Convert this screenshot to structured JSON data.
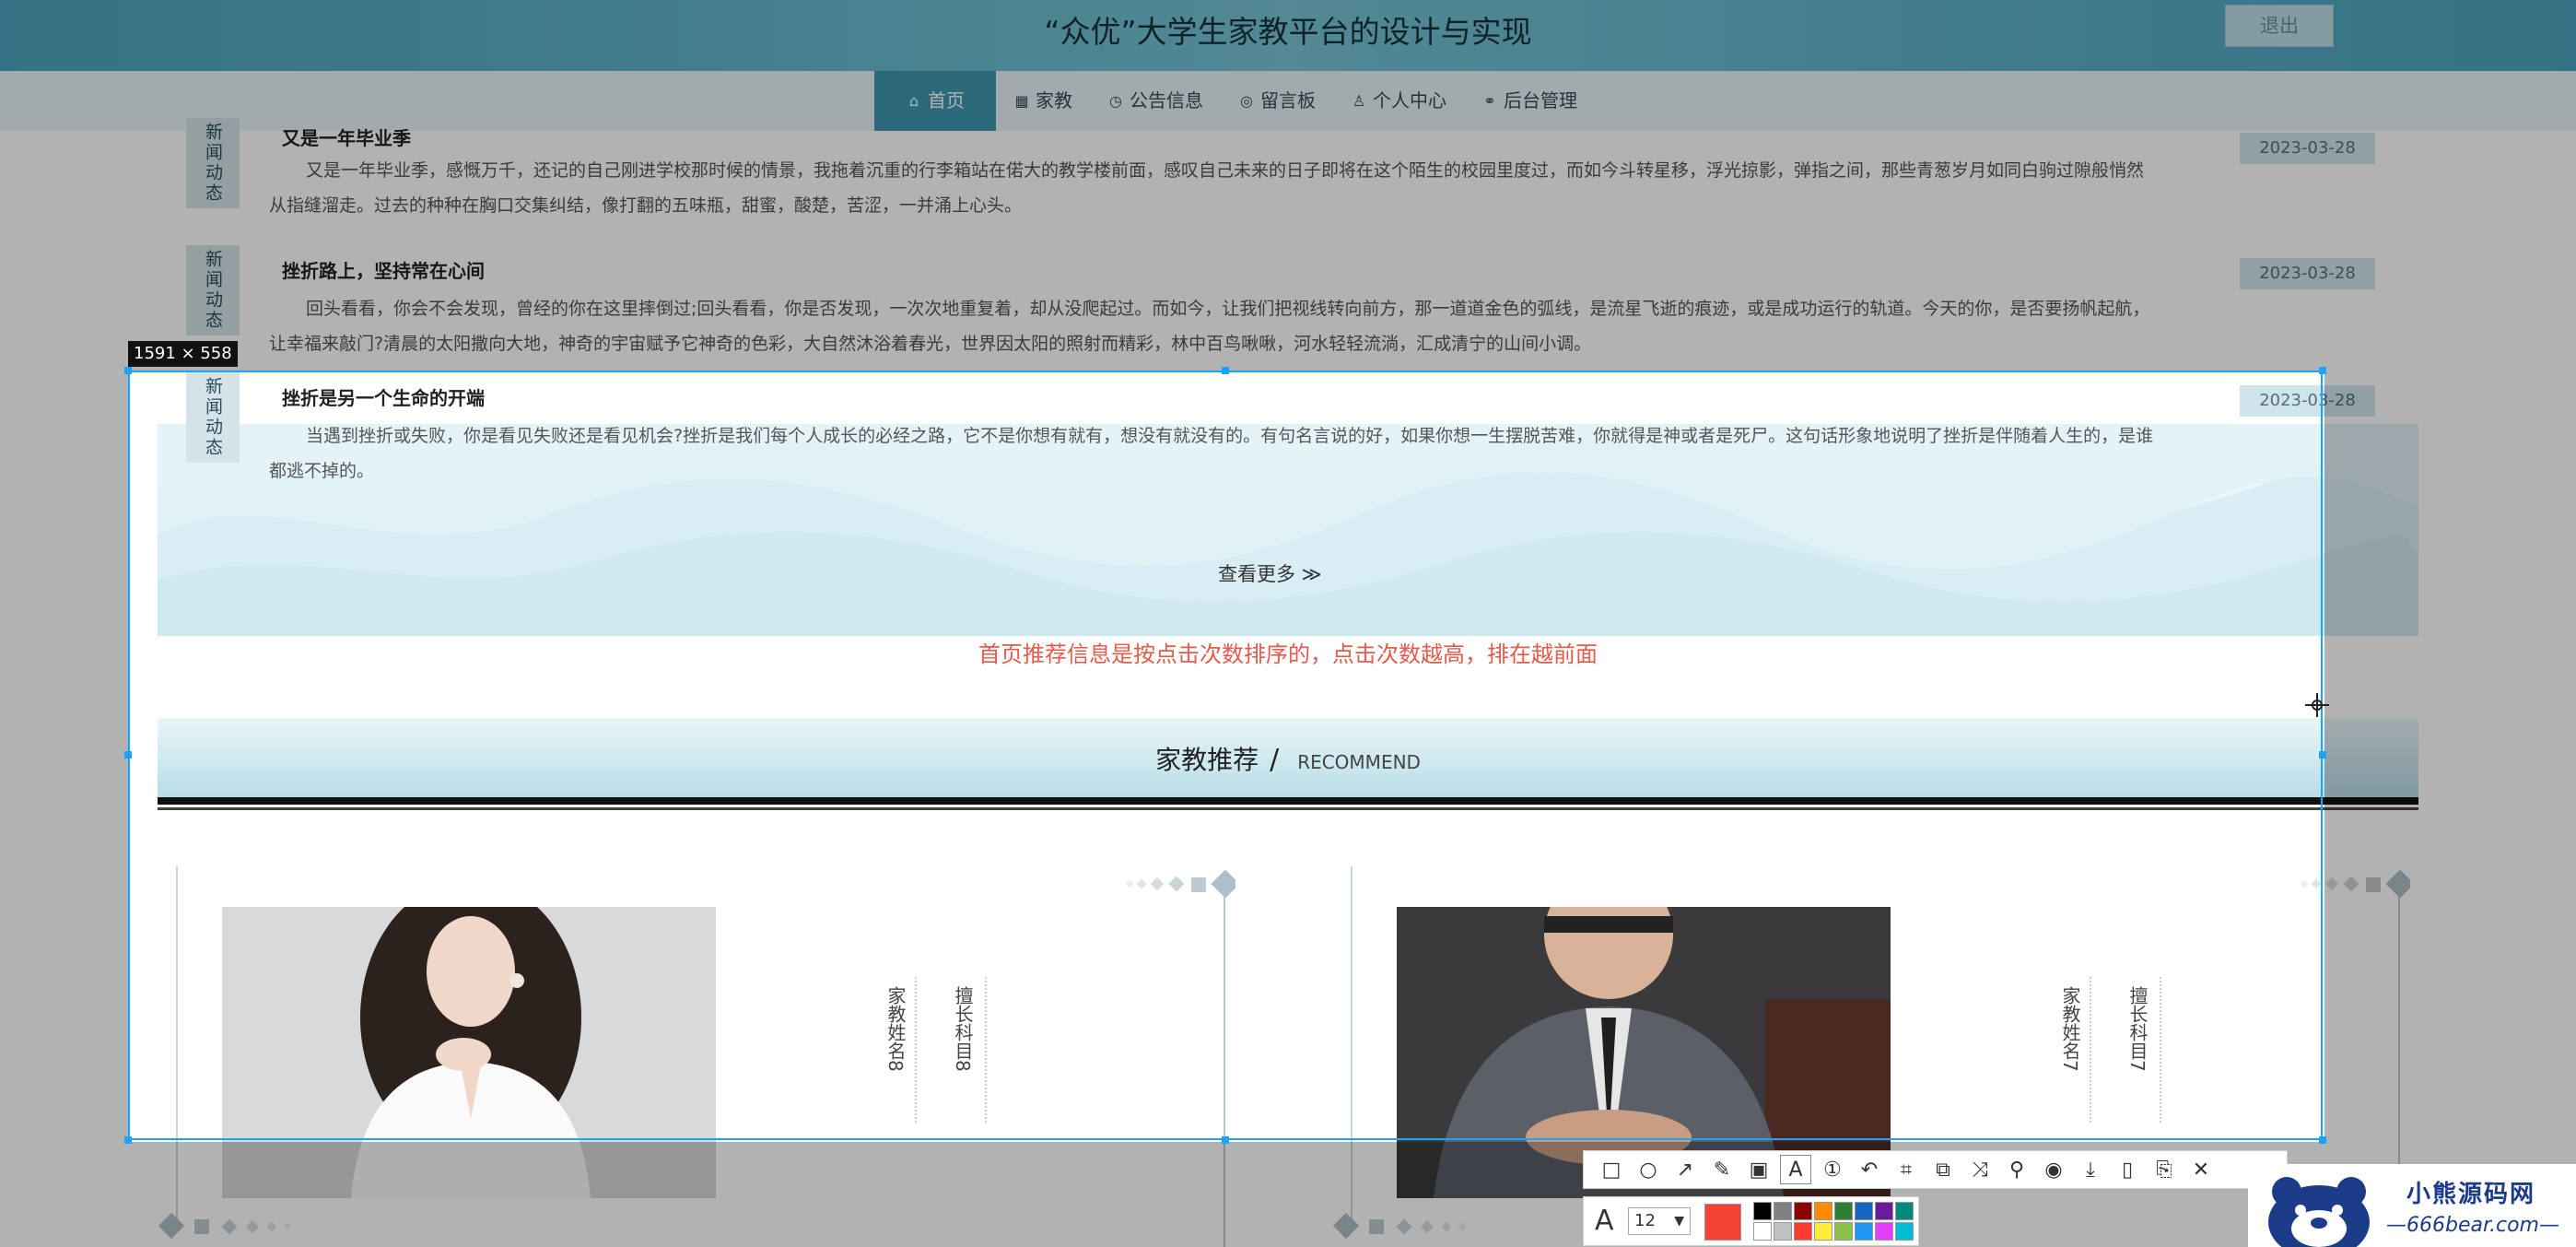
{
  "header": {
    "title": "“众优”大学生家教平台的设计与实现",
    "logout_label": "退出"
  },
  "nav": [
    {
      "label": "首页",
      "icon": "home-icon",
      "glyph": "⌂",
      "active": true
    },
    {
      "label": "家教",
      "icon": "calendar-icon",
      "glyph": "▦",
      "active": false
    },
    {
      "label": "公告信息",
      "icon": "clock-icon",
      "glyph": "◷",
      "active": false
    },
    {
      "label": "留言板",
      "icon": "globe-icon",
      "glyph": "◎",
      "active": false
    },
    {
      "label": "个人中心",
      "icon": "user-icon",
      "glyph": "♙",
      "active": false
    },
    {
      "label": "后台管理",
      "icon": "link-icon",
      "glyph": "⚭",
      "active": false
    }
  ],
  "news": {
    "tag": "新闻动态",
    "items": [
      {
        "title": "又是一年毕业季",
        "date": "2023-03-28",
        "body": "又是一年毕业季，感慨万千，还记的自己刚进学校那时候的情景，我拖着沉重的行李箱站在偌大的教学楼前面，感叹自己未来的日子即将在这个陌生的校园里度过，而如今斗转星移，浮光掠影，弹指之间，那些青葱岁月如同白驹过隙般悄然从指缝溜走。过去的种种在胸口交集纠结，像打翻的五味瓶，甜蜜，酸楚，苦涩，一并涌上心头。"
      },
      {
        "title": "挫折路上，坚持常在心间",
        "date": "2023-03-28",
        "body": "回头看看，你会不会发现，曾经的你在这里摔倒过;回头看看，你是否发现，一次次地重复着，却从没爬起过。而如今，让我们把视线转向前方，那一道道金色的弧线，是流星飞逝的痕迹，或是成功运行的轨道。今天的你，是否要扬帆起航，让幸福来敲门?清晨的太阳撒向大地，神奇的宇宙赋予它神奇的色彩，大自然沐浴着春光，世界因太阳的照射而精彩，林中百鸟啾啾，河水轻轻流淌，汇成清宁的山间小调。"
      },
      {
        "title": "挫折是另一个生命的开端",
        "date": "2023-03-28",
        "body": "当遇到挫折或失败，你是看见失败还是看见机会?挫折是我们每个人成长的必经之路，它不是你想有就有，想没有就没有的。有句名言说的好，如果你想一生摆脱苦难，你就得是神或者是死尸。这句话形象地说明了挫折是伴随着人生的，是谁都逃不掉的。"
      }
    ]
  },
  "more_label": "查看更多 ≫",
  "hint": "首页推荐信息是按点击次数排序的，点击次数越高，排在越前面",
  "recommend": {
    "title": "家教推荐",
    "slash": "/",
    "subtitle": "RECOMMEND"
  },
  "tutors": [
    {
      "name_label": "家教姓名",
      "name_value": "8",
      "subject_label": "擅长科目",
      "subject_value": "8",
      "photo": "woman-photo"
    },
    {
      "name_label": "家教姓名",
      "name_value": "7",
      "subject_label": "擅长科目",
      "subject_value": "7",
      "photo": "man-photo"
    }
  ],
  "screenshot_tool": {
    "size_label": "1591 × 558",
    "font_size": "12",
    "current_color": "#f44336",
    "palette": [
      "#000000",
      "#808080",
      "#8b0000",
      "#ff8c00",
      "#2e7d32",
      "#1565c0",
      "#6a1b9a",
      "#00897b",
      "#ffffff",
      "#c0c0c0",
      "#ff3b30",
      "#ffeb3b",
      "#8bc34a",
      "#2196f3",
      "#e040fb",
      "#00bcd4"
    ],
    "tools": [
      "rectangle-icon",
      "ellipse-icon",
      "arrow-icon",
      "pen-icon",
      "mosaic-icon",
      "text-icon",
      "number-icon",
      "undo-icon",
      "ocr-icon",
      "translate-icon",
      "scroll-icon",
      "pin-icon",
      "record-icon",
      "save-icon",
      "phone-icon",
      "bookmark-icon",
      "close-icon"
    ]
  },
  "watermark": {
    "title": "小熊源码网",
    "url": "—666bear.com—"
  }
}
